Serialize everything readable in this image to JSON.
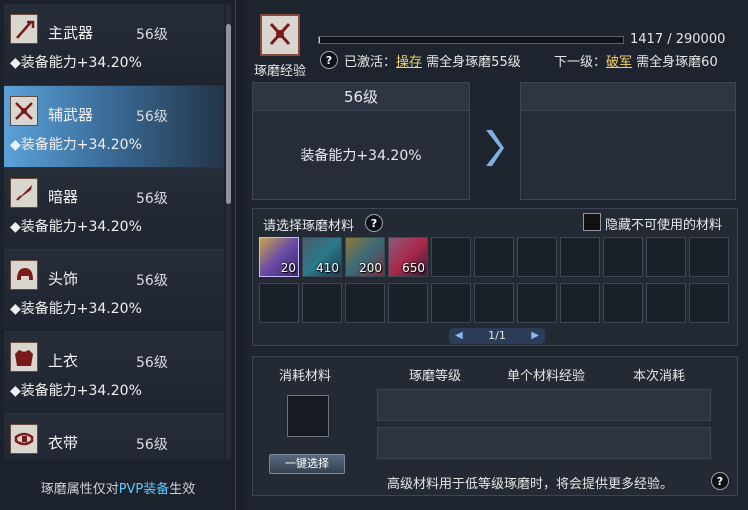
{
  "sidebar": {
    "items": [
      {
        "name": "主武器",
        "level": "56级",
        "bonus": "◆装备能力+34.20%",
        "icon": "spear-icon",
        "active": false
      },
      {
        "name": "辅武器",
        "level": "56级",
        "bonus": "◆装备能力+34.20%",
        "icon": "crossed-blades-icon",
        "active": true
      },
      {
        "name": "暗器",
        "level": "56级",
        "bonus": "◆装备能力+34.20%",
        "icon": "dart-icon",
        "active": false
      },
      {
        "name": "头饰",
        "level": "56级",
        "bonus": "◆装备能力+34.20%",
        "icon": "helmet-icon",
        "active": false
      },
      {
        "name": "上衣",
        "level": "56级",
        "bonus": "◆装备能力+34.20%",
        "icon": "armor-icon",
        "active": false
      },
      {
        "name": "衣带",
        "level": "56级",
        "bonus": "◆装备能力+34.20%",
        "icon": "belt-icon",
        "active": false
      }
    ],
    "footnote_pre": "琢磨属性仅对",
    "footnote_hl": "PVP装备",
    "footnote_post": "生效"
  },
  "header": {
    "label": "琢磨经验",
    "exp_text": "1417 / 290000",
    "exp_progress": 0.0049,
    "q": "?",
    "activated_label": "已激活：",
    "activated_name": "操存",
    "activated_req": "需全身琢磨55级",
    "next_label": "下一级：",
    "next_name": "破军",
    "next_req": "需全身琢磨60"
  },
  "current": {
    "level": "56级",
    "bonus": "装备能力+34.20%"
  },
  "materials": {
    "title": "请选择琢磨材料",
    "q": "?",
    "hide_label": "隐藏不可使用的材料",
    "items": [
      {
        "count": "20",
        "type": "it1"
      },
      {
        "count": "410",
        "type": "it2"
      },
      {
        "count": "200",
        "type": "it3"
      },
      {
        "count": "650",
        "type": "it4"
      }
    ],
    "total_slots": 22,
    "page": "1/1"
  },
  "consume": {
    "col1": "消耗材料",
    "col2": "琢磨等级",
    "col3": "单个材料经验",
    "col4": "本次消耗",
    "one_key": "一键选择",
    "hint": "高级材料用于低等级琢磨时，将会提供更多经验。",
    "q": "?"
  },
  "colors": {
    "accent": "#5fc7ff",
    "highlight": "#f2d16b",
    "active_row": "#5aa2d8"
  }
}
